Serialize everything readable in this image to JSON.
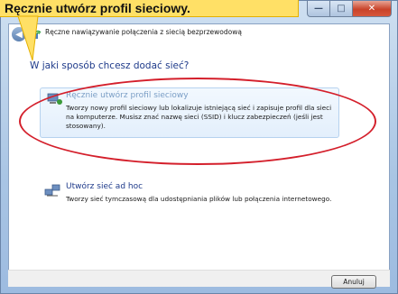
{
  "callout": {
    "text": "Ręcznie utwórz profil sieciowy."
  },
  "window": {
    "title": "Ręczne nawiązywanie połączenia z siecią bezprzewodową",
    "controls": {
      "minimize": "—",
      "maximize": "□",
      "close": "✕"
    }
  },
  "question": "W jaki sposób chcesz dodać sieć?",
  "options": [
    {
      "title": "Ręcznie utwórz profil sieciowy",
      "description": "Tworzy nowy profil sieciowy lub lokalizuje istniejącą sieć i zapisuje profil dla sieci na komputerze. Musisz znać nazwę sieci (SSID) i klucz zabezpieczeń (jeśli jest stosowany).",
      "icon": "network-computer-icon",
      "highlighted": true
    },
    {
      "title": "Utwórz sieć ad hoc",
      "description": "Tworzy sieć tymczasową dla udostępniania plików lub połączenia internetowego.",
      "icon": "adhoc-network-icon",
      "highlighted": false
    }
  ],
  "buttons": {
    "cancel": "Anuluj"
  },
  "colors": {
    "annotation": "#d41f2b",
    "callout": "#ffe066",
    "link": "#1e3a8a"
  }
}
